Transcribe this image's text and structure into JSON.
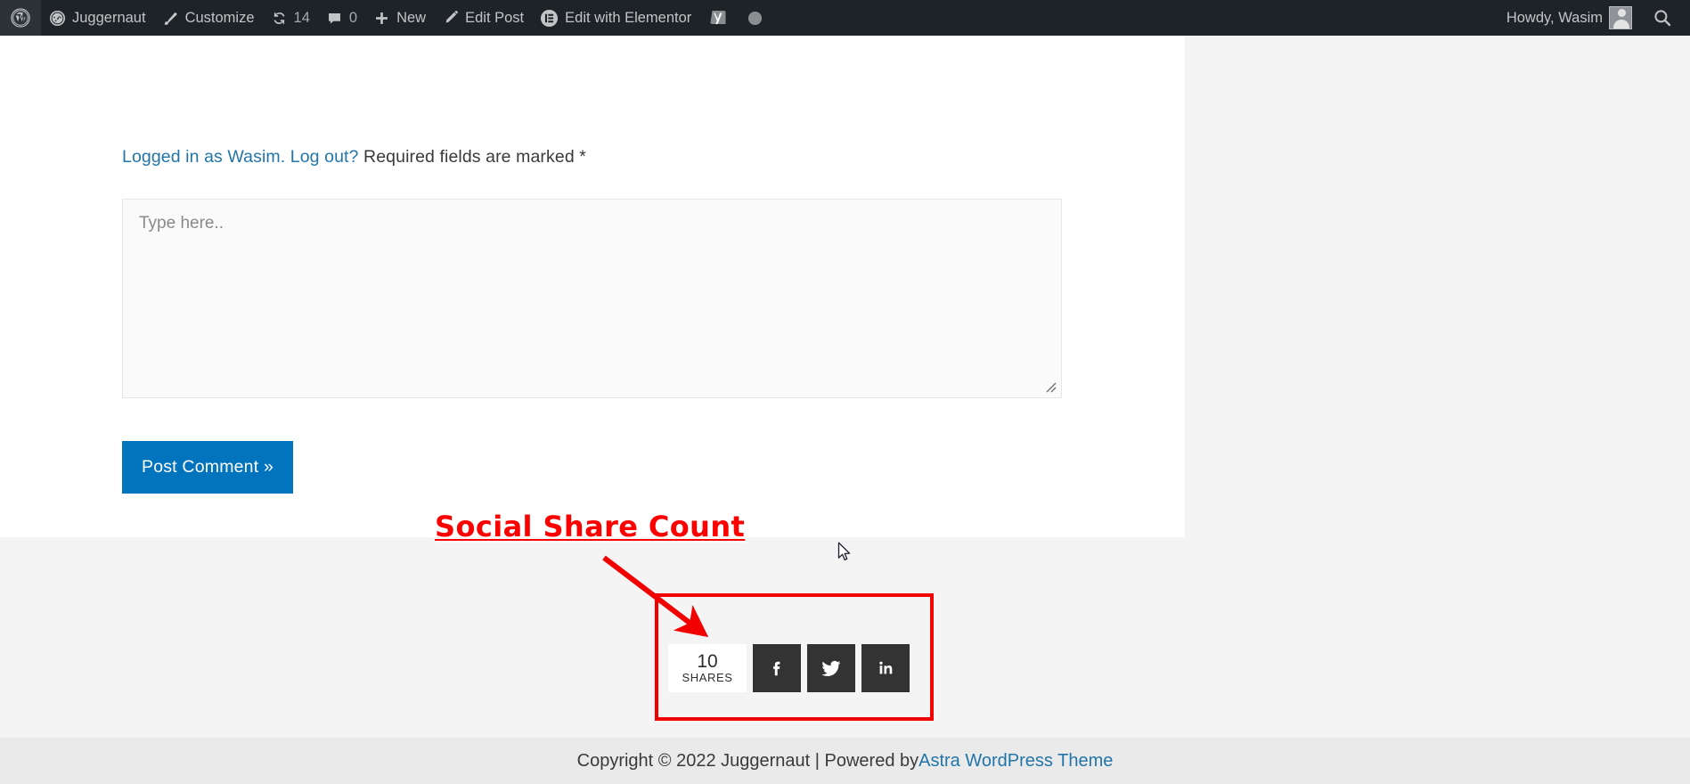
{
  "admin_bar": {
    "wordpress_logo_label": "W",
    "items": [
      {
        "name": "site-name",
        "label": "Juggernaut",
        "icon": "dashboard-icon"
      },
      {
        "name": "customize",
        "label": "Customize",
        "icon": "paintbrush-icon"
      },
      {
        "name": "updates",
        "label": "14",
        "icon": "updates-icon"
      },
      {
        "name": "comments",
        "label": "0",
        "icon": "comment-bubble-icon"
      },
      {
        "name": "new-content",
        "label": "New",
        "icon": "plus-icon"
      },
      {
        "name": "edit-post",
        "label": "Edit Post",
        "icon": "pencil-icon"
      },
      {
        "name": "edit-with-elementor",
        "label": "Edit with Elementor",
        "icon": "elementor-icon"
      }
    ],
    "yoast_label": "Y",
    "greeting": "Howdy, Wasim",
    "search_label": "Search"
  },
  "comment_form": {
    "logged_in_prefix": "Logged in as Wasim.",
    "logout_label": "Log out?",
    "required_note": "Required fields are marked *",
    "textarea_placeholder": "Type here..",
    "textarea_value": "",
    "submit_label": "Post Comment »"
  },
  "annotation": {
    "label": "Social Share Count",
    "color": "#fc0000",
    "box_color": "#f20000"
  },
  "social_share": {
    "count": "10",
    "count_label": "SHARES",
    "buttons": [
      {
        "name": "share-facebook-button",
        "icon": "facebook-icon",
        "label": "Facebook"
      },
      {
        "name": "share-twitter-button",
        "icon": "twitter-icon",
        "label": "Twitter"
      },
      {
        "name": "share-linkedin-button",
        "icon": "linkedin-icon",
        "label": "LinkedIn"
      }
    ],
    "button_color": "#333333"
  },
  "footer": {
    "copyright_text": "Copyright © 2022 Juggernaut | Powered by ",
    "theme_link_label": "Astra WordPress Theme"
  }
}
